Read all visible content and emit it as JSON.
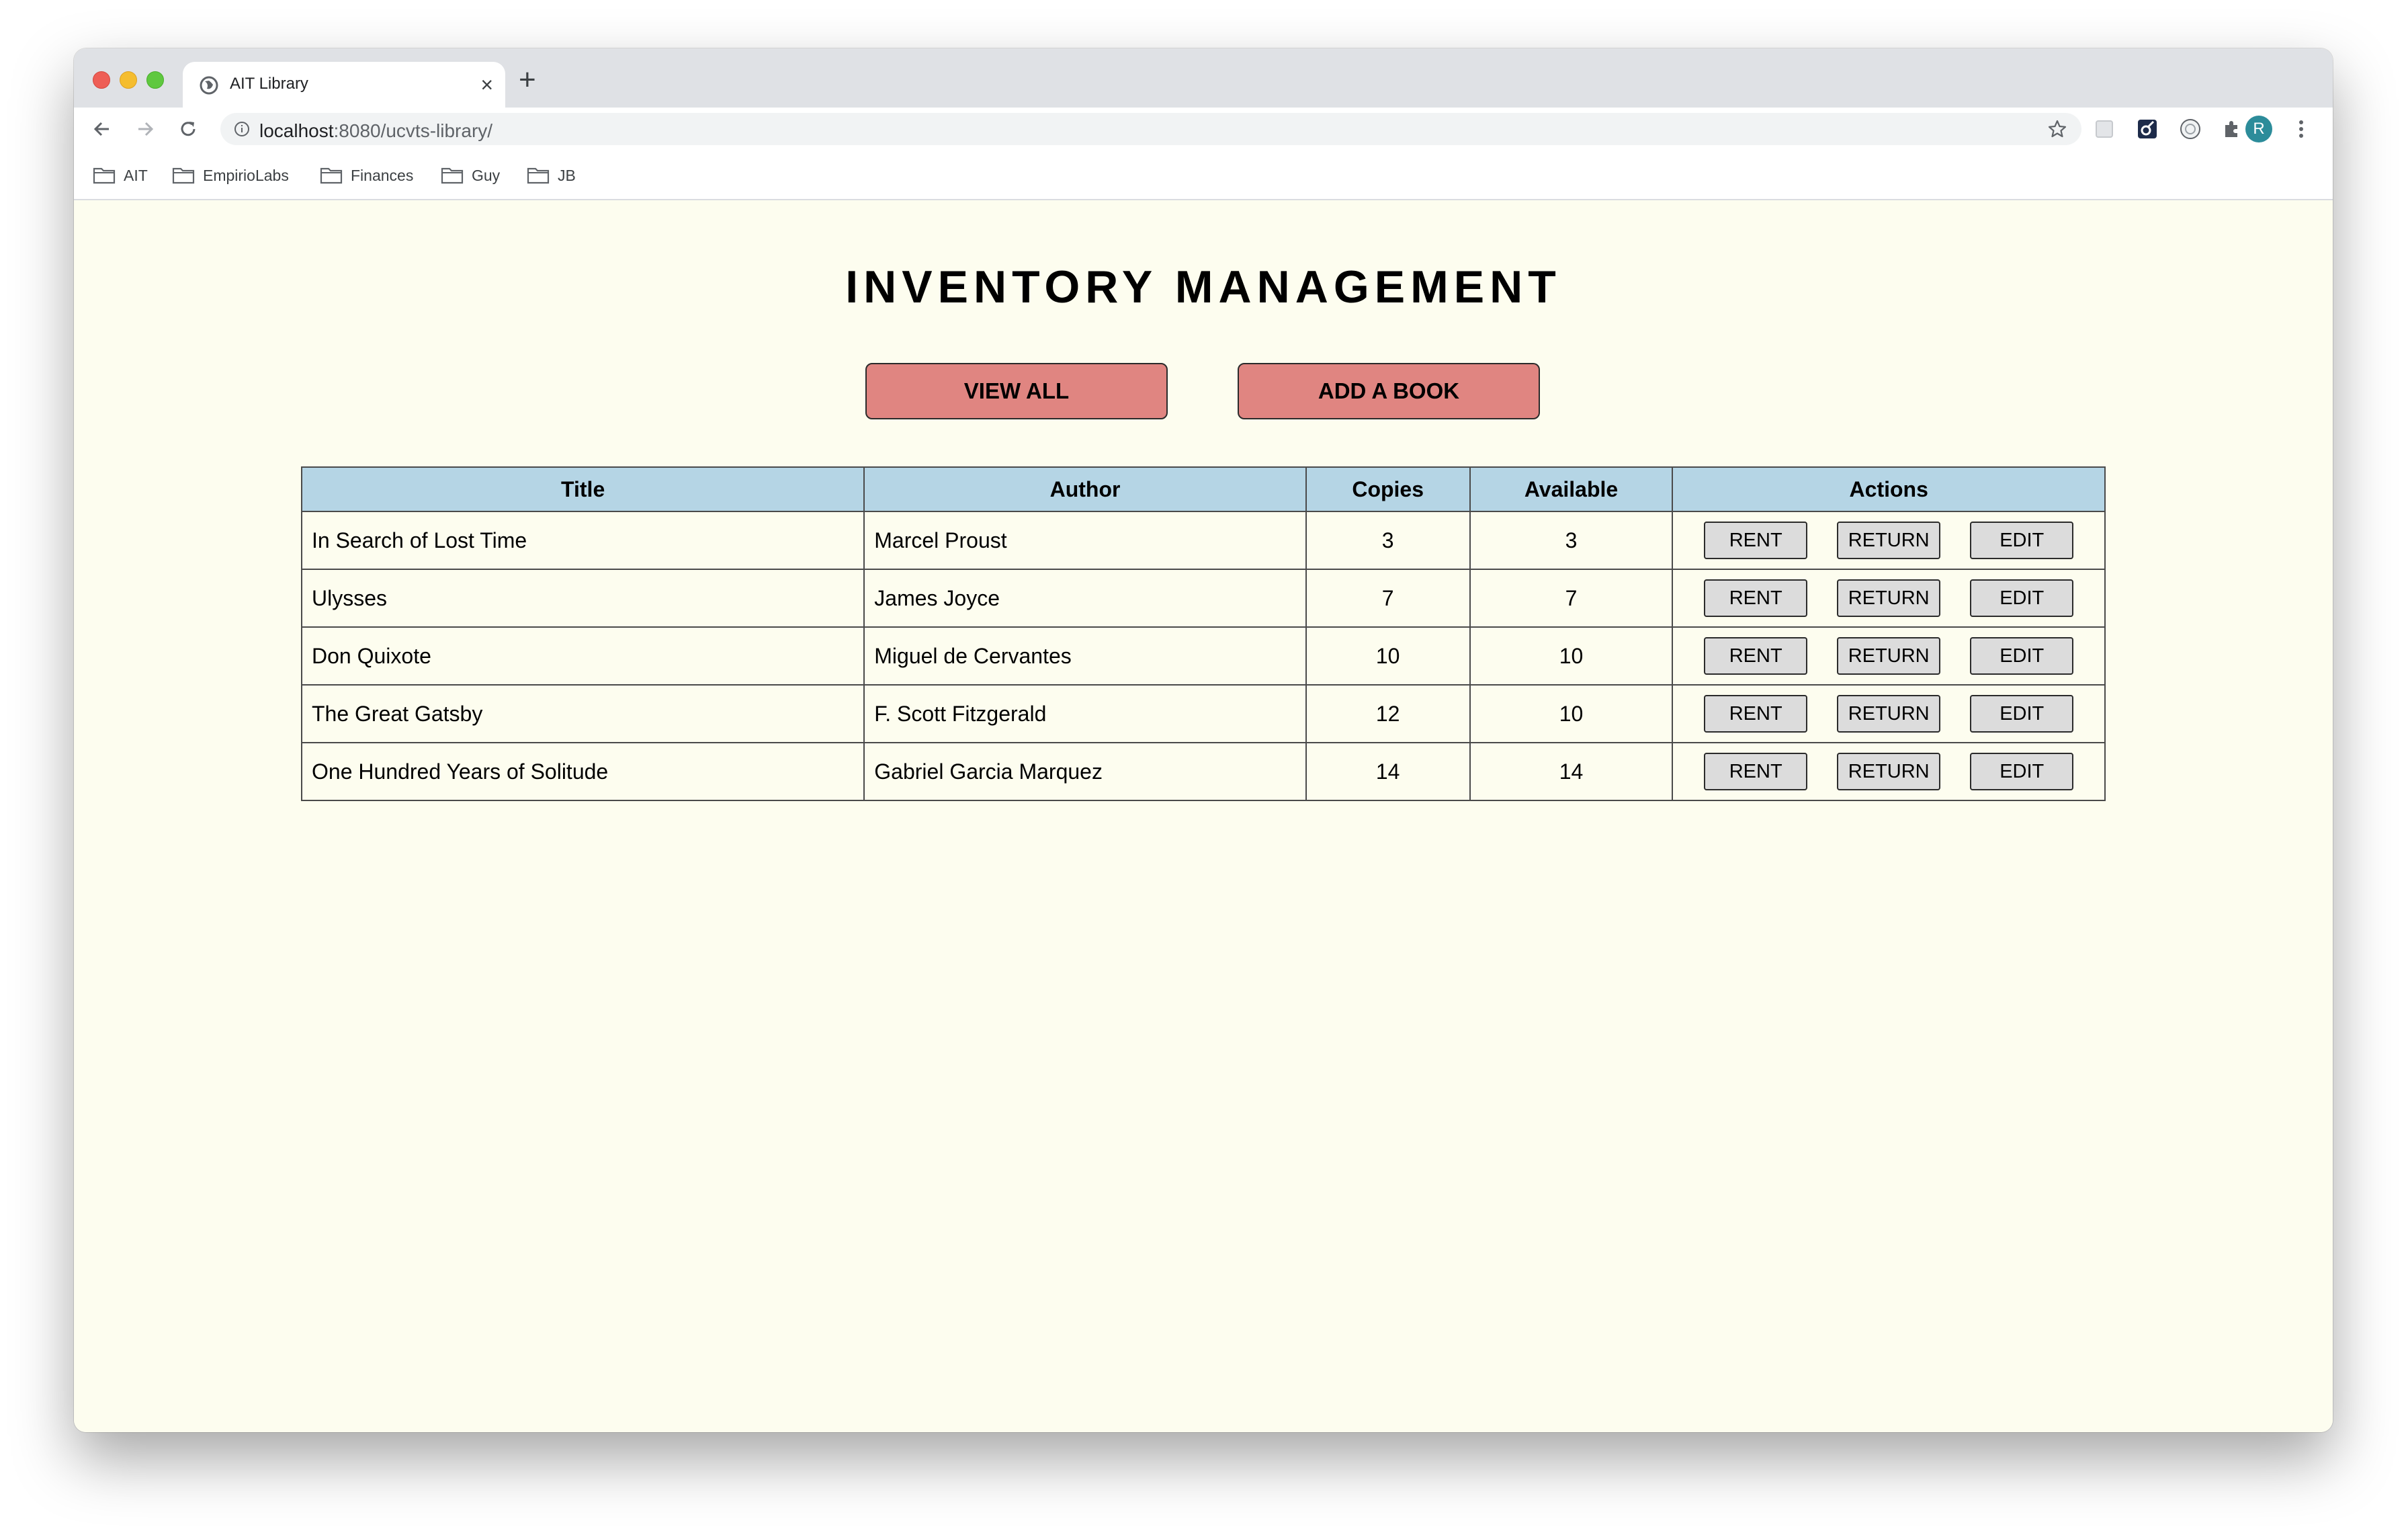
{
  "browser": {
    "tab_title": "AIT Library",
    "url_host": "localhost",
    "url_rest": ":8080/ucvts-library/",
    "avatar_letter": "R",
    "bookmarks": [
      "AIT",
      "EmpirioLabs",
      "Finances",
      "Guy",
      "JB"
    ]
  },
  "page": {
    "title": "INVENTORY MANAGEMENT",
    "view_all_label": "VIEW ALL",
    "add_book_label": "ADD A BOOK"
  },
  "table": {
    "headers": [
      "Title",
      "Author",
      "Copies",
      "Available",
      "Actions"
    ],
    "rows": [
      {
        "title": "In Search of Lost Time",
        "author": "Marcel Proust",
        "copies": "3",
        "available": "3"
      },
      {
        "title": "Ulysses",
        "author": "James Joyce",
        "copies": "7",
        "available": "7"
      },
      {
        "title": "Don Quixote",
        "author": "Miguel de Cervantes",
        "copies": "10",
        "available": "10"
      },
      {
        "title": "The Great Gatsby",
        "author": "F. Scott Fitzgerald",
        "copies": "12",
        "available": "10"
      },
      {
        "title": "One Hundred Years of Solitude",
        "author": "Gabriel Garcia Marquez",
        "copies": "14",
        "available": "14"
      }
    ],
    "action_labels": {
      "rent": "RENT",
      "return": "RETURN",
      "edit": "EDIT"
    }
  },
  "colors": {
    "page_background": "#fdfdef",
    "header_background": "#b5d5e5",
    "primary_button": "#e08581",
    "action_button": "#dcdcdc"
  }
}
